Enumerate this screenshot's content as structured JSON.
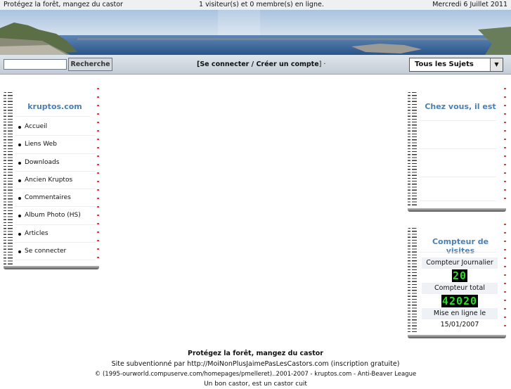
{
  "header": {
    "slogan": "Protégez la forêt, mangez du castor",
    "visitors": "1 visiteur(s) et 0 membre(s) en ligne.",
    "date": "Mercredi 6 Juillet 2011"
  },
  "toolbar": {
    "search_value": "",
    "search_button": "Recherche",
    "open_bracket": "[",
    "login_link": "Se connecter / Créer un compte",
    "close_bracket": "] ·",
    "topics_select": "Tous les Sujets"
  },
  "left_block": {
    "title": "kruptos.com",
    "items": [
      {
        "label": "Accueil"
      },
      {
        "label": "Liens Web"
      },
      {
        "label": "Downloads"
      },
      {
        "label": "Ancien Kruptos"
      },
      {
        "label": "Commentaires"
      },
      {
        "label": "Album Photo (HS)"
      },
      {
        "label": "Articles"
      },
      {
        "label": "Se connecter"
      }
    ]
  },
  "right_block_top": {
    "title": "Chez vous, il est"
  },
  "counter_block": {
    "title": "Compteur de visites",
    "daily_label": "Compteur Journalier",
    "daily_value": "20",
    "total_label": "Compteur total",
    "total_value": "42020",
    "online_label": "Mise en ligne le",
    "online_date": "15/01/2007"
  },
  "footer": {
    "slogan": "Protégez la forêt, mangez du castor",
    "line2": "Site subventionné par http://MoiNonPlusJaimePasLesCastors.com (inscription gratuite)",
    "line3": "© (1995-ourworld.compuserve.com/homepages/pmelleret)..2001-2007 - kruptos.com - Anti-Beaver League",
    "line4": "Un bon castor, est un castor cuit"
  },
  "colors": {
    "accent_title": "#4a7fb5",
    "counter_digits": "#2bdd2b",
    "sea": "#2f5f96",
    "sky": "#9cb8d6"
  }
}
